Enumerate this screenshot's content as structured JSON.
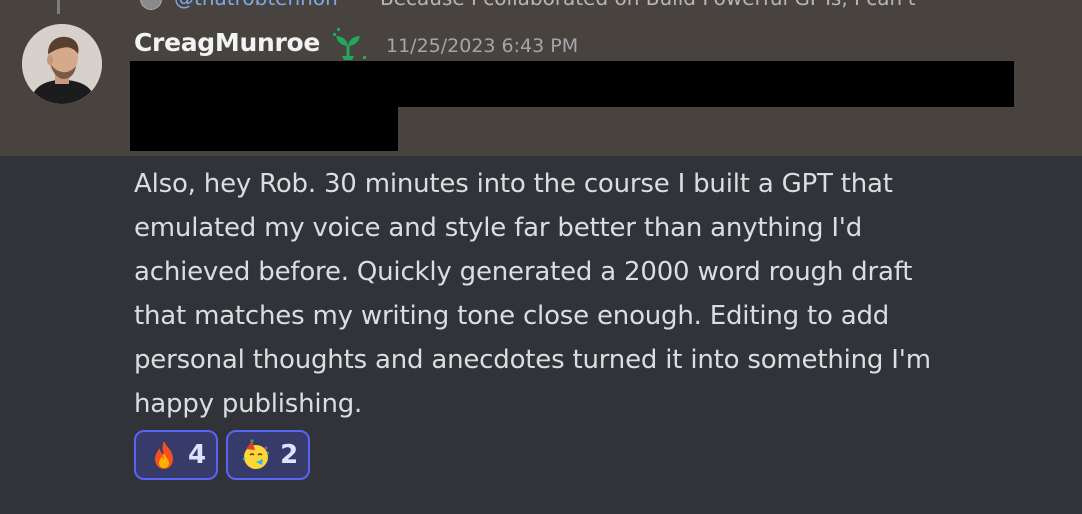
{
  "reply": {
    "mention": "@thatrobtennon",
    "text": "Because I collaborated on Build Powerful GPTs, I can't"
  },
  "message": {
    "author": "CreagMunroe",
    "timestamp": "11/25/2023 6:43 PM",
    "body_lines": [
      "Also, hey Rob. 30 minutes into the course I built a GPT that",
      "emulated my voice and style far better than anything I'd",
      "achieved before. Quickly generated a 2000 word rough draft",
      "that matches my writing tone close enough. Editing to add",
      "personal thoughts and anecdotes turned it into something I'm",
      "happy publishing."
    ]
  },
  "reactions": [
    {
      "emoji": "fire-emoji",
      "count": "4"
    },
    {
      "emoji": "partying-face-emoji",
      "count": "2"
    }
  ],
  "colors": {
    "highlight_band": "#48433f",
    "background": "#313338",
    "role_icon": "#23a55a",
    "reaction_border": "#5865f2",
    "mention": "#7fa8e6"
  }
}
